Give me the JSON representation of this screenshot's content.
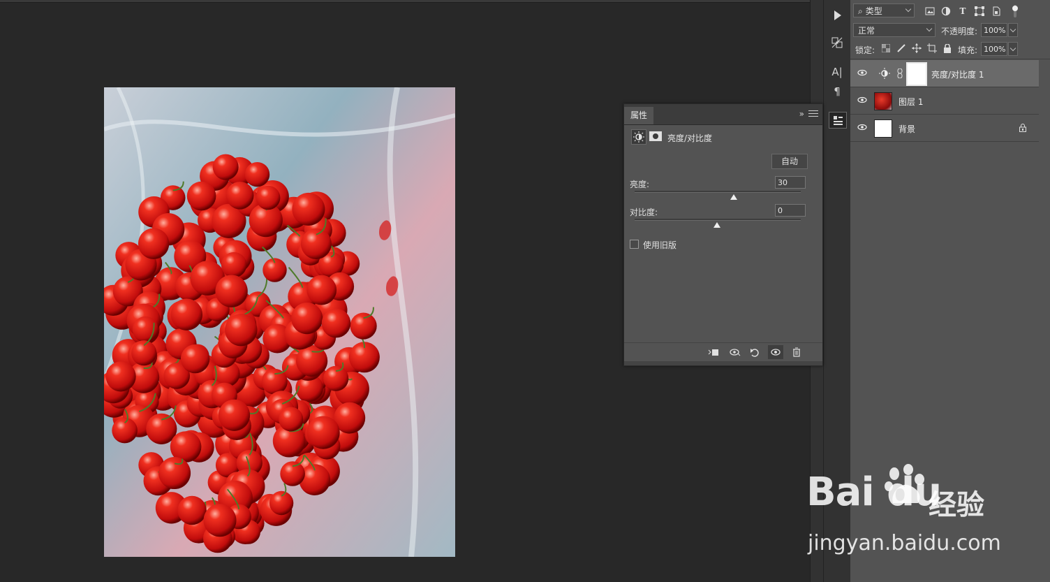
{
  "properties_panel": {
    "tab_label": "属性",
    "collapse_glyph": "»",
    "adjustment_title": "亮度/对比度",
    "auto_label": "自动",
    "brightness_label": "亮度:",
    "brightness_value": "30",
    "contrast_label": "对比度:",
    "contrast_value": "0",
    "legacy_label": "使用旧版"
  },
  "layers_panel": {
    "filter_kind": "类型",
    "blend_mode": "正常",
    "opacity_label": "不透明度:",
    "opacity_value": "100%",
    "lock_label": "锁定:",
    "fill_label": "填充:",
    "fill_value": "100%",
    "layers": [
      {
        "name": "亮度/对比度 1",
        "type": "adjustment"
      },
      {
        "name": "图层 1",
        "type": "image"
      },
      {
        "name": "背景",
        "type": "background"
      }
    ]
  },
  "tool_strip": {
    "text_glyph": "A|",
    "para_glyph": "¶"
  },
  "watermark": {
    "logo": "Bai du",
    "logo_cn": "经验",
    "url": "jingyan.baidu.com"
  },
  "colors": {
    "panel_bg": "#535353",
    "canvas_bg": "#282828",
    "annotation_arrow": "#e8323a"
  }
}
